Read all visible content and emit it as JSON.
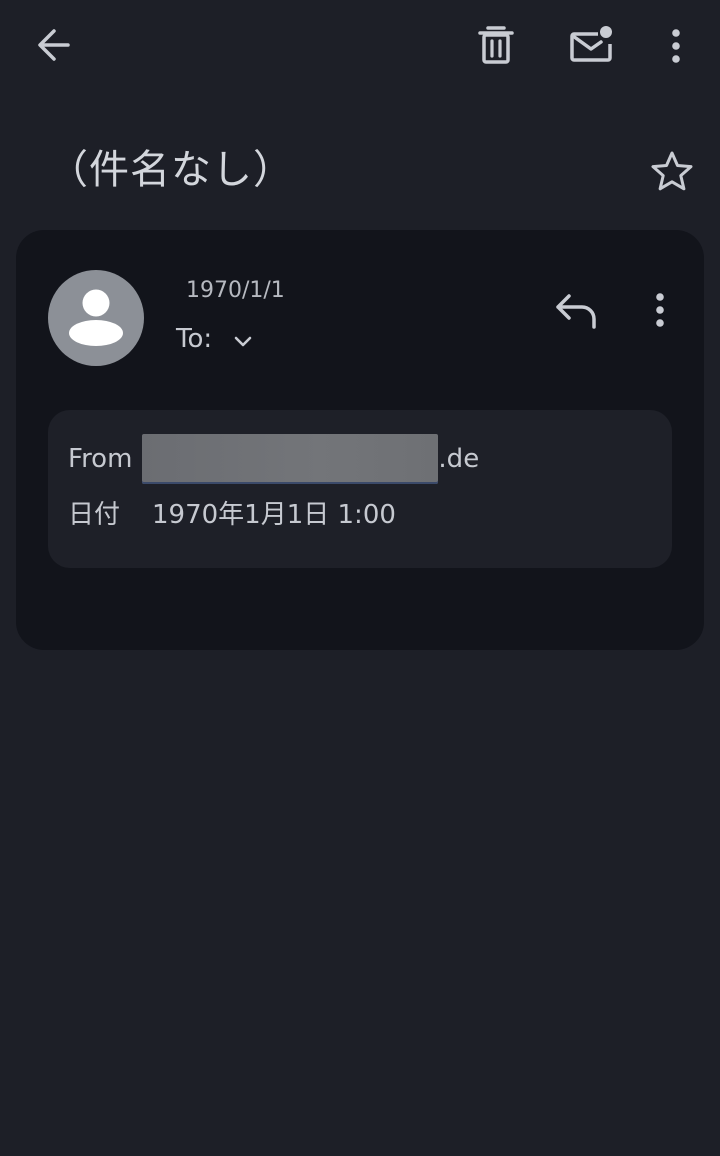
{
  "toolbar": {
    "back_icon": "arrow-left-icon",
    "delete_icon": "trash-icon",
    "mark_unread_icon": "mail-unread-icon",
    "more_icon": "more-vert-icon"
  },
  "message": {
    "subject": "（件名なし）",
    "star_icon": "star-outline-icon",
    "date_short": "1970/1/1",
    "to_label": "To:",
    "details": {
      "from_label": "From",
      "from_domain_suffix": ".de",
      "date_label": "日付",
      "date_value": "1970年1月1日 1:00"
    }
  },
  "colors": {
    "background": "#1d1f27",
    "card": "#12141b",
    "details_panel": "#1e2028",
    "avatar": "#8c9097",
    "text": "#c9ccd3"
  }
}
